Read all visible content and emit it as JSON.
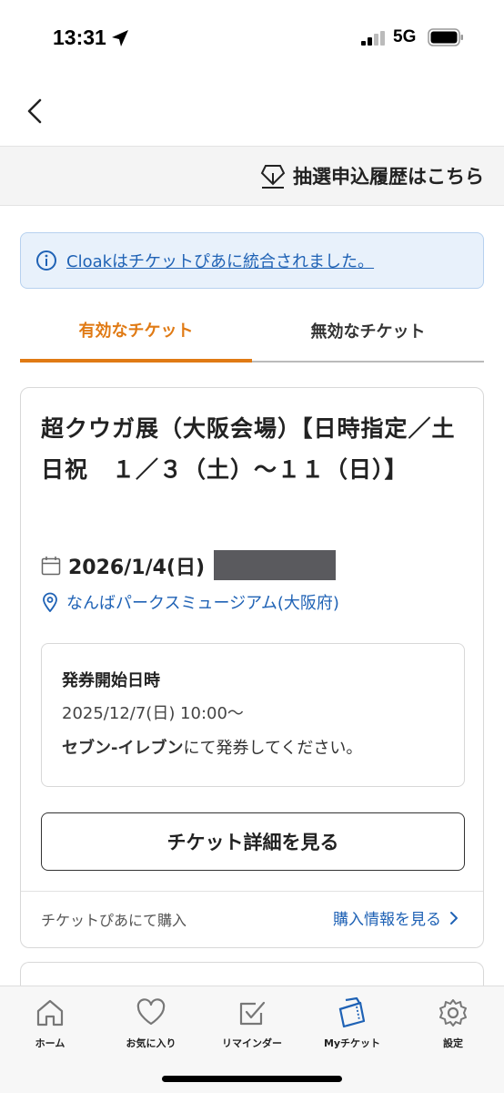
{
  "status_bar": {
    "time": "13:31",
    "network": "5G"
  },
  "header": {
    "lottery_history_label": "抽選申込履歴はこちら"
  },
  "notice": {
    "text": "Cloakはチケットぴあに統合されました。"
  },
  "tabs": [
    {
      "label": "有効なチケット",
      "active": true
    },
    {
      "label": "無効なチケット",
      "active": false
    }
  ],
  "ticket": {
    "title": "超クウガ展（大阪会場）【日時指定／土日祝　１／３（土）～１１（日）】",
    "date": "2026/1/4(日)",
    "venue": "なんばパークスミュージアム(大阪府)",
    "issue_label": "発券開始日時",
    "issue_date": "2025/12/7(日) 10:00～",
    "issue_store": "セブン-イレブン",
    "issue_suffix": "にて発券してください。",
    "detail_button": "チケット詳細を見る",
    "purchase_source": "チケットぴあにて購入",
    "purchase_info_link": "購入情報を見る"
  },
  "tabbar": [
    {
      "label": "ホーム",
      "icon": "home-icon"
    },
    {
      "label": "お気に入り",
      "icon": "heart-icon"
    },
    {
      "label": "リマインダー",
      "icon": "checkbox-icon"
    },
    {
      "label": "Myチケット",
      "icon": "ticket-icon",
      "active": true
    },
    {
      "label": "設定",
      "icon": "gear-icon"
    }
  ],
  "colors": {
    "accent": "#e07a14",
    "link": "#1f62b5",
    "notice_bg": "#e8f1fb"
  }
}
